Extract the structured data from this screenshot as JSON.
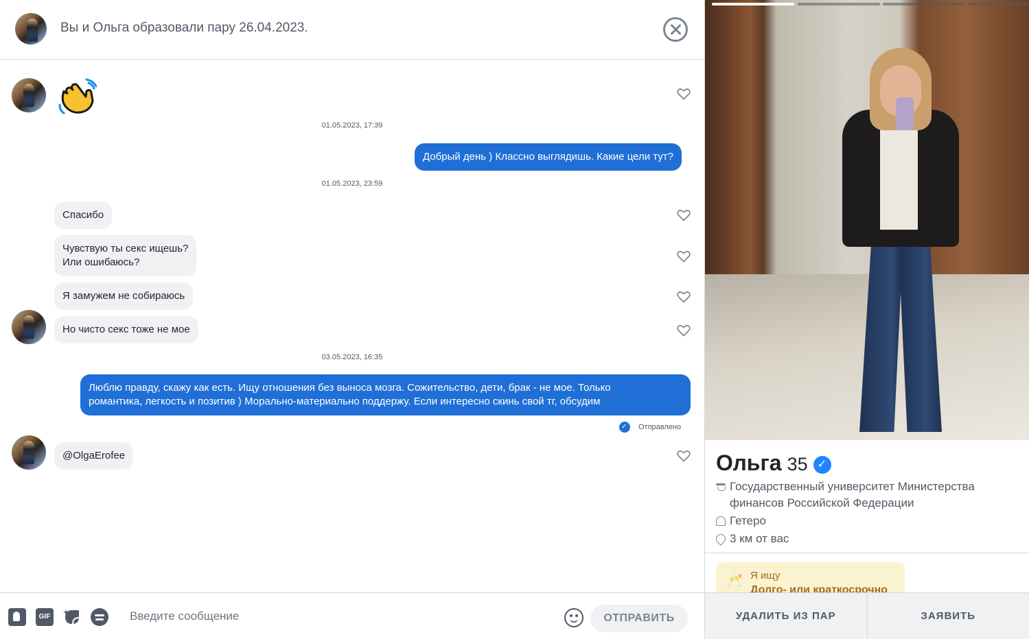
{
  "header": {
    "match_text": "Вы и Ольга образовали пару 26.04.2023."
  },
  "messages": {
    "wave_emoji": "👋",
    "ts1": "01.05.2023, 17:39",
    "out1": "Добрый день ) Классно выглядишь. Какие цели тут?",
    "ts2": "01.05.2023, 23:59",
    "in1": "Спасибо",
    "in2_line1": "Чувствую ты секс ищешь?",
    "in2_line2": "Или ошибаюсь?",
    "in3": "Я замужем не собираюсь",
    "in4": "Но чисто секс тоже не мое",
    "ts3": "03.05.2023, 16:35",
    "out2_line1": "Люблю правду, скажу как есть. Ищу отношения без выноса мозга. Сожительство, дети, брак - не мое. Только",
    "out2_line2": "романтика, легкость и позитив ) Морально-материально поддержу. Если интересно скинь свой тг, обсудим",
    "sent_status": "Отправлено",
    "in5": "@OlgaErofee"
  },
  "composer": {
    "gif_label": "GIF",
    "placeholder": "Введите сообщение",
    "send_label": "ОТПРАВИТЬ"
  },
  "profile": {
    "name": "Ольга",
    "age": "35",
    "school": "Государственный университет Министерства финансов Российской Федерации",
    "orientation": "Гетеро",
    "distance": "3 км от вас",
    "looking_title": "Я ищу",
    "looking_value": "Долго- или краткосрочно",
    "looking_icon": "🥂",
    "photo_count": 4,
    "photo_active_index": 0
  },
  "actions": {
    "unmatch_label": "УДАЛИТЬ ИЗ ПАР",
    "report_label": "ЗАЯВИТЬ"
  },
  "colors": {
    "outgoing_bubble": "#1f6fd6",
    "incoming_bubble": "#f0f1f3",
    "verified_badge": "#1f86ff"
  },
  "icons": [
    "close-icon",
    "heart-icon",
    "contact-icon",
    "gif-icon",
    "sticker-icon",
    "spotify-icon",
    "emoji-icon",
    "school-icon",
    "person-icon",
    "location-pin-icon",
    "verified-icon",
    "champagne-icon"
  ]
}
